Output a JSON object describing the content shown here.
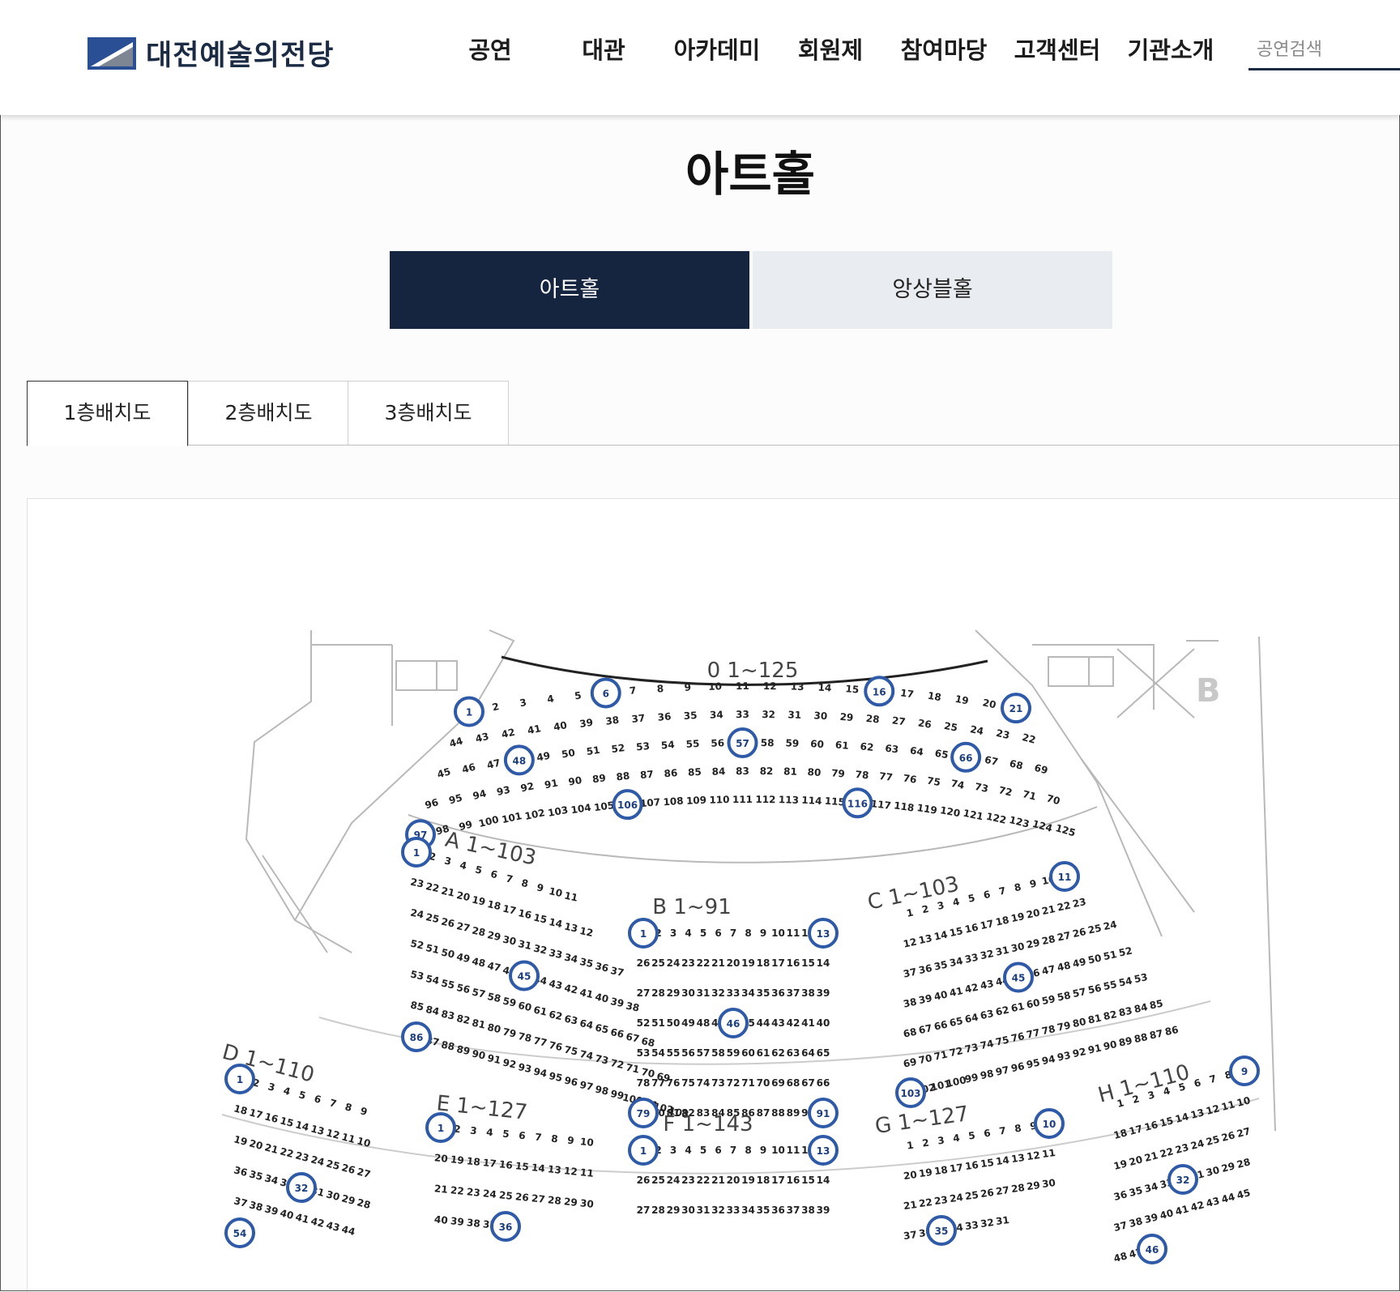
{
  "header": {
    "logo_text": "대전예술의전당",
    "nav": [
      "공연",
      "대관",
      "아카데미",
      "회원제",
      "참여마당",
      "고객센터",
      "기관소개"
    ],
    "search_placeholder": "공연검색"
  },
  "page_title": "아트홀",
  "hall_tabs": {
    "active": "아트홀",
    "other": "앙상블홀"
  },
  "floor_tabs": [
    "1층배치도",
    "2층배치도",
    "3층배치도"
  ],
  "seat_map": {
    "sections": [
      {
        "label": "0 1~125",
        "seats": [
          [
            "1",
            "2",
            "3",
            "4",
            "5",
            "6",
            "7",
            "8",
            "9",
            "10",
            "11",
            "12",
            "13",
            "14",
            "15",
            "16",
            "17",
            "18",
            "19",
            "20",
            "21"
          ],
          [
            "44",
            "43",
            "42",
            "41",
            "40",
            "39",
            "38",
            "37",
            "36",
            "35",
            "34",
            "33",
            "32",
            "31",
            "30",
            "29",
            "28",
            "27",
            "26",
            "25",
            "24",
            "23",
            "22"
          ],
          [
            "45",
            "46",
            "47",
            "48",
            "49",
            "50",
            "51",
            "52",
            "53",
            "54",
            "55",
            "56",
            "57",
            "58",
            "59",
            "60",
            "61",
            "62",
            "63",
            "64",
            "65",
            "66",
            "67",
            "68",
            "69"
          ],
          [
            "96",
            "95",
            "94",
            "93",
            "92",
            "91",
            "90",
            "89",
            "88",
            "87",
            "86",
            "85",
            "84",
            "83",
            "82",
            "81",
            "80",
            "79",
            "78",
            "77",
            "76",
            "75",
            "74",
            "73",
            "72",
            "71",
            "70"
          ],
          [
            "97",
            "98",
            "99",
            "100",
            "101",
            "102",
            "103",
            "104",
            "105",
            "106",
            "107",
            "108",
            "109",
            "110",
            "111",
            "112",
            "113",
            "114",
            "115",
            "116",
            "117",
            "118",
            "119",
            "120",
            "121",
            "122",
            "123",
            "124",
            "125"
          ]
        ]
      },
      {
        "label": "A 1~103",
        "seats": [
          [
            "1",
            "2",
            "3",
            "4",
            "5",
            "6",
            "7",
            "8",
            "9",
            "10",
            "11"
          ],
          [
            "23",
            "22",
            "21",
            "20",
            "19",
            "18",
            "17",
            "16",
            "15",
            "14",
            "13",
            "12"
          ],
          [
            "24",
            "25",
            "26",
            "27",
            "28",
            "29",
            "30",
            "31",
            "32",
            "33",
            "34",
            "35",
            "36",
            "37"
          ],
          [
            "52",
            "51",
            "50",
            "49",
            "48",
            "47",
            "46",
            "45",
            "44",
            "43",
            "42",
            "41",
            "40",
            "39",
            "38"
          ],
          [
            "53",
            "54",
            "55",
            "56",
            "57",
            "58",
            "59",
            "60",
            "61",
            "62",
            "63",
            "64",
            "65",
            "66",
            "67",
            "68"
          ],
          [
            "85",
            "84",
            "83",
            "82",
            "81",
            "80",
            "79",
            "78",
            "77",
            "76",
            "75",
            "74",
            "73",
            "72",
            "71",
            "70",
            "69"
          ],
          [
            "86",
            "87",
            "88",
            "89",
            "90",
            "91",
            "92",
            "93",
            "94",
            "95",
            "96",
            "97",
            "98",
            "99",
            "100",
            "101",
            "102",
            "103"
          ]
        ]
      },
      {
        "label": "B 1~91",
        "seats": [
          [
            "1",
            "2",
            "3",
            "4",
            "5",
            "6",
            "7",
            "8",
            "9",
            "10",
            "11",
            "12",
            "13"
          ],
          [
            "26",
            "25",
            "24",
            "23",
            "22",
            "21",
            "20",
            "19",
            "18",
            "17",
            "16",
            "15",
            "14"
          ],
          [
            "27",
            "28",
            "29",
            "30",
            "31",
            "32",
            "33",
            "34",
            "35",
            "36",
            "37",
            "38",
            "39"
          ],
          [
            "52",
            "51",
            "50",
            "49",
            "48",
            "47",
            "46",
            "45",
            "44",
            "43",
            "42",
            "41",
            "40"
          ],
          [
            "53",
            "54",
            "55",
            "56",
            "57",
            "58",
            "59",
            "60",
            "61",
            "62",
            "63",
            "64",
            "65"
          ],
          [
            "78",
            "77",
            "76",
            "75",
            "74",
            "73",
            "72",
            "71",
            "70",
            "69",
            "68",
            "67",
            "66"
          ],
          [
            "79",
            "80",
            "81",
            "82",
            "83",
            "84",
            "85",
            "86",
            "87",
            "88",
            "89",
            "90",
            "91"
          ]
        ]
      },
      {
        "label": "C 1~103",
        "seats": [
          [
            "1",
            "2",
            "3",
            "4",
            "5",
            "6",
            "7",
            "8",
            "9",
            "10",
            "11"
          ],
          [
            "12",
            "13",
            "14",
            "15",
            "16",
            "17",
            "18",
            "19",
            "20",
            "21",
            "22",
            "23"
          ],
          [
            "37",
            "36",
            "35",
            "34",
            "33",
            "32",
            "31",
            "30",
            "29",
            "28",
            "27",
            "26",
            "25",
            "24"
          ],
          [
            "38",
            "39",
            "40",
            "41",
            "42",
            "43",
            "44",
            "45",
            "46",
            "47",
            "48",
            "49",
            "50",
            "51",
            "52"
          ],
          [
            "68",
            "67",
            "66",
            "65",
            "64",
            "63",
            "62",
            "61",
            "60",
            "59",
            "58",
            "57",
            "56",
            "55",
            "54",
            "53"
          ],
          [
            "69",
            "70",
            "71",
            "72",
            "73",
            "74",
            "75",
            "76",
            "77",
            "78",
            "79",
            "80",
            "81",
            "82",
            "83",
            "84",
            "85"
          ],
          [
            "103",
            "102",
            "101",
            "100",
            "99",
            "98",
            "97",
            "96",
            "95",
            "94",
            "93",
            "92",
            "91",
            "90",
            "89",
            "88",
            "87",
            "86"
          ]
        ]
      },
      {
        "label": "D 1~110",
        "seats": [
          [
            "1",
            "2",
            "3",
            "4",
            "5",
            "6",
            "7",
            "8",
            "9"
          ],
          [
            "18",
            "17",
            "16",
            "15",
            "14",
            "13",
            "12",
            "11",
            "10"
          ],
          [
            "19",
            "20",
            "21",
            "22",
            "23",
            "24",
            "25",
            "26",
            "27"
          ],
          [
            "36",
            "35",
            "34",
            "33",
            "32",
            "31",
            "30",
            "29",
            "28"
          ],
          [
            "37",
            "38",
            "39",
            "40",
            "41",
            "42",
            "43",
            "44"
          ],
          [
            "54"
          ]
        ]
      },
      {
        "label": "E 1~127",
        "seats": [
          [
            "1",
            "2",
            "3",
            "4",
            "5",
            "6",
            "7",
            "8",
            "9",
            "10"
          ],
          [
            "20",
            "19",
            "18",
            "17",
            "16",
            "15",
            "14",
            "13",
            "12",
            "11"
          ],
          [
            "21",
            "22",
            "23",
            "24",
            "25",
            "26",
            "27",
            "28",
            "29",
            "30"
          ],
          [
            "40",
            "39",
            "38",
            "37",
            "36"
          ]
        ]
      },
      {
        "label": "F 1~143",
        "seats": [
          [
            "1",
            "2",
            "3",
            "4",
            "5",
            "6",
            "7",
            "8",
            "9",
            "10",
            "11",
            "12",
            "13"
          ],
          [
            "26",
            "25",
            "24",
            "23",
            "22",
            "21",
            "20",
            "19",
            "18",
            "17",
            "16",
            "15",
            "14"
          ],
          [
            "27",
            "28",
            "29",
            "30",
            "31",
            "32",
            "33",
            "34",
            "35",
            "36",
            "37",
            "38",
            "39"
          ]
        ]
      },
      {
        "label": "G 1~127",
        "seats": [
          [
            "1",
            "2",
            "3",
            "4",
            "5",
            "6",
            "7",
            "8",
            "9",
            "10"
          ],
          [
            "20",
            "19",
            "18",
            "17",
            "16",
            "15",
            "14",
            "13",
            "12",
            "11"
          ],
          [
            "21",
            "22",
            "23",
            "24",
            "25",
            "26",
            "27",
            "28",
            "29",
            "30"
          ],
          [
            "37",
            "36",
            "35",
            "34",
            "33",
            "32",
            "31"
          ]
        ]
      },
      {
        "label": "H 1~110",
        "seats": [
          [
            "1",
            "2",
            "3",
            "4",
            "5",
            "6",
            "7",
            "8",
            "9"
          ],
          [
            "18",
            "17",
            "16",
            "15",
            "14",
            "13",
            "12",
            "11",
            "10"
          ],
          [
            "19",
            "20",
            "21",
            "22",
            "23",
            "24",
            "25",
            "26",
            "27"
          ],
          [
            "36",
            "35",
            "34",
            "33",
            "32",
            "31",
            "30",
            "29",
            "28"
          ],
          [
            "37",
            "38",
            "39",
            "40",
            "41",
            "42",
            "43",
            "44",
            "45"
          ],
          [
            "48",
            "47",
            "46"
          ]
        ]
      }
    ],
    "markers": [
      {
        "section": 0,
        "seat": "1"
      },
      {
        "section": 0,
        "seat": "6"
      },
      {
        "section": 0,
        "seat": "16"
      },
      {
        "section": 0,
        "seat": "21"
      },
      {
        "section": 0,
        "seat": "48"
      },
      {
        "section": 0,
        "seat": "57"
      },
      {
        "section": 0,
        "seat": "66"
      },
      {
        "section": 0,
        "seat": "97"
      },
      {
        "section": 0,
        "seat": "106"
      },
      {
        "section": 0,
        "seat": "116"
      },
      {
        "section": 1,
        "seat": "1"
      },
      {
        "section": 1,
        "seat": "45"
      },
      {
        "section": 1,
        "seat": "86"
      },
      {
        "section": 2,
        "seat": "1"
      },
      {
        "section": 2,
        "seat": "13"
      },
      {
        "section": 2,
        "seat": "46"
      },
      {
        "section": 2,
        "seat": "79"
      },
      {
        "section": 2,
        "seat": "91"
      },
      {
        "section": 3,
        "seat": "11"
      },
      {
        "section": 3,
        "seat": "45"
      },
      {
        "section": 3,
        "seat": "103"
      },
      {
        "section": 4,
        "seat": "1"
      },
      {
        "section": 4,
        "seat": "32"
      },
      {
        "section": 4,
        "seat": "54"
      },
      {
        "section": 5,
        "seat": "1"
      },
      {
        "section": 5,
        "seat": "36"
      },
      {
        "section": 6,
        "seat": "1"
      },
      {
        "section": 6,
        "seat": "13"
      },
      {
        "section": 7,
        "seat": "10"
      },
      {
        "section": 7,
        "seat": "35"
      },
      {
        "section": 8,
        "seat": "9"
      },
      {
        "section": 8,
        "seat": "32"
      },
      {
        "section": 8,
        "seat": "46"
      }
    ],
    "stage_mark": "B"
  },
  "colors": {
    "navy": "#15253f",
    "marker": "#2f5aa8",
    "tab_inactive": "#e9ecf0"
  }
}
